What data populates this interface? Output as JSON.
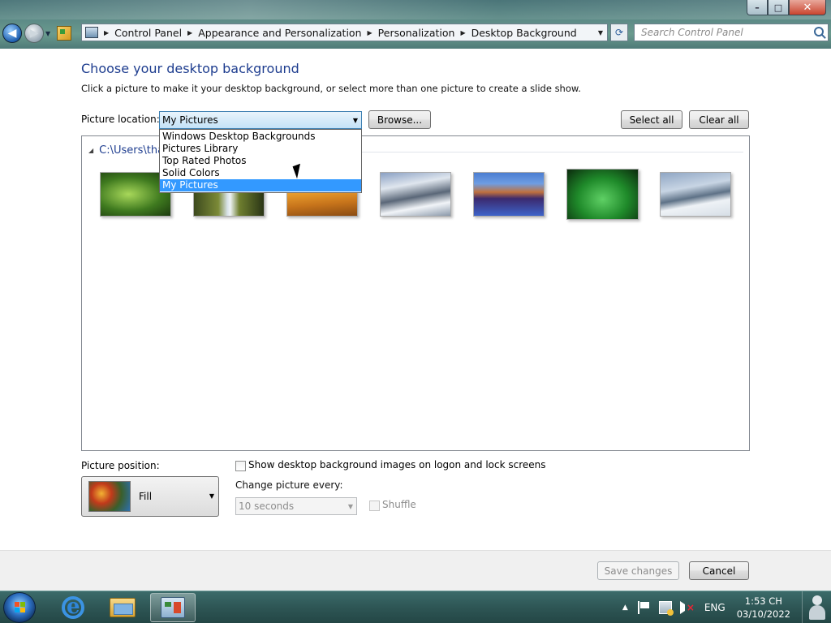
{
  "window": {
    "caption_buttons": {
      "minimize": "–",
      "maximize": "□",
      "close": "✕"
    }
  },
  "nav": {
    "back_icon": "back-arrow-icon",
    "forward_icon": "forward-arrow-icon"
  },
  "breadcrumb": {
    "items": [
      {
        "label": "Control Panel"
      },
      {
        "label": "Appearance and Personalization"
      },
      {
        "label": "Personalization"
      },
      {
        "label": "Desktop Background"
      }
    ]
  },
  "search": {
    "placeholder": "Search Control Panel"
  },
  "page": {
    "title": "Choose your desktop background",
    "subtitle": "Click a picture to make it your desktop background, or select more than one picture to create a slide show."
  },
  "picture_location": {
    "label": "Picture location:",
    "value": "My Pictures",
    "options": [
      {
        "label": "Windows Desktop Backgrounds",
        "selected": false
      },
      {
        "label": "Pictures Library",
        "selected": false
      },
      {
        "label": "Top Rated Photos",
        "selected": false
      },
      {
        "label": "Solid Colors",
        "selected": false
      },
      {
        "label": "My Pictures",
        "selected": true
      }
    ],
    "browse_label": "Browse...",
    "select_all_label": "Select all",
    "clear_all_label": "Clear all"
  },
  "gallery": {
    "folder_path": "C:\\Users\\tha",
    "thumbnails": [
      {
        "name": "fern"
      },
      {
        "name": "waterfall"
      },
      {
        "name": "desert-dunes"
      },
      {
        "name": "snowy-mountains"
      },
      {
        "name": "mountain-lake"
      },
      {
        "name": "green-plant"
      },
      {
        "name": "snowy-slope"
      }
    ]
  },
  "picture_position": {
    "label": "Picture position:",
    "value": "Fill"
  },
  "logon_option": {
    "label": "Show desktop background images on logon and lock screens",
    "checked": false
  },
  "slideshow": {
    "change_label": "Change picture every:",
    "interval": "10 seconds",
    "shuffle_label": "Shuffle",
    "shuffle_checked": false
  },
  "footer": {
    "save_label": "Save changes",
    "cancel_label": "Cancel"
  },
  "taskbar": {
    "apps": [
      {
        "name": "internet-explorer"
      },
      {
        "name": "windows-explorer"
      },
      {
        "name": "control-panel",
        "active": true
      }
    ],
    "tray": {
      "language": "ENG",
      "time": "1:53 CH",
      "date": "03/10/2022"
    }
  }
}
